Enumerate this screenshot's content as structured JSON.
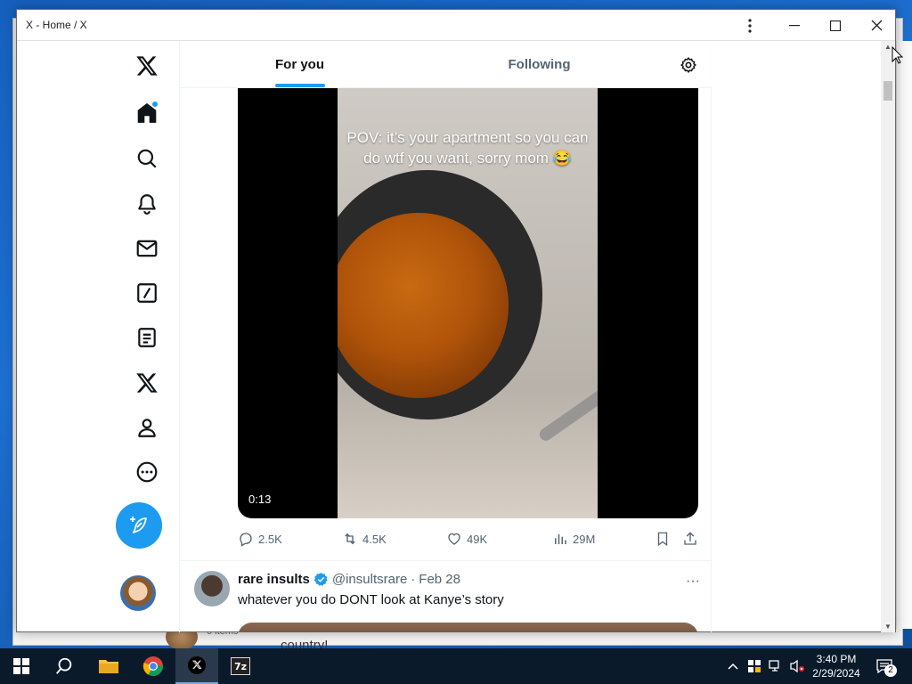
{
  "window": {
    "title": "X - Home / X",
    "controls": {
      "more": "⋮",
      "minimize": "—",
      "maximize": "☐",
      "close": "✕"
    }
  },
  "nav": {
    "items": [
      {
        "name": "x-logo-icon"
      },
      {
        "name": "home-icon",
        "has_notification_dot": true
      },
      {
        "name": "search-icon"
      },
      {
        "name": "notifications-bell-icon"
      },
      {
        "name": "messages-envelope-icon"
      },
      {
        "name": "grok-icon"
      },
      {
        "name": "lists-icon"
      },
      {
        "name": "premium-x-icon"
      },
      {
        "name": "profile-person-icon"
      },
      {
        "name": "more-circle-icon"
      }
    ],
    "post_button_icon": "feather-plus-icon"
  },
  "tabs": [
    {
      "label": "For you",
      "active": true
    },
    {
      "label": "Following",
      "active": false
    }
  ],
  "tweet1": {
    "video_caption": "POV: it’s your apartment so you can do wtf you want, sorry mom 😂",
    "duration": "0:13",
    "replies": "2.5K",
    "reposts": "4.5K",
    "likes": "49K",
    "views": "29M"
  },
  "tweet2": {
    "name": "rare insults",
    "handle": "@insultsrare",
    "date": "Feb 28",
    "separator": "·",
    "text": "whatever you do DONT look at Kanye’s story",
    "more": "···"
  },
  "background_window": {
    "text": "country!",
    "items_label": "0 items"
  },
  "taskbar": {
    "apps": [
      "start-icon",
      "search-icon",
      "file-explorer-icon",
      "chrome-icon",
      "x-app-icon",
      "7zip-icon"
    ],
    "seven_zip_label": "7z",
    "time": "3:40 PM",
    "date": "2/29/2024",
    "notification_count": "2"
  },
  "colors": {
    "accent": "#1d9bf0",
    "text_primary": "#0f1419",
    "text_secondary": "#536471",
    "taskbar": "#0b1a2a"
  }
}
